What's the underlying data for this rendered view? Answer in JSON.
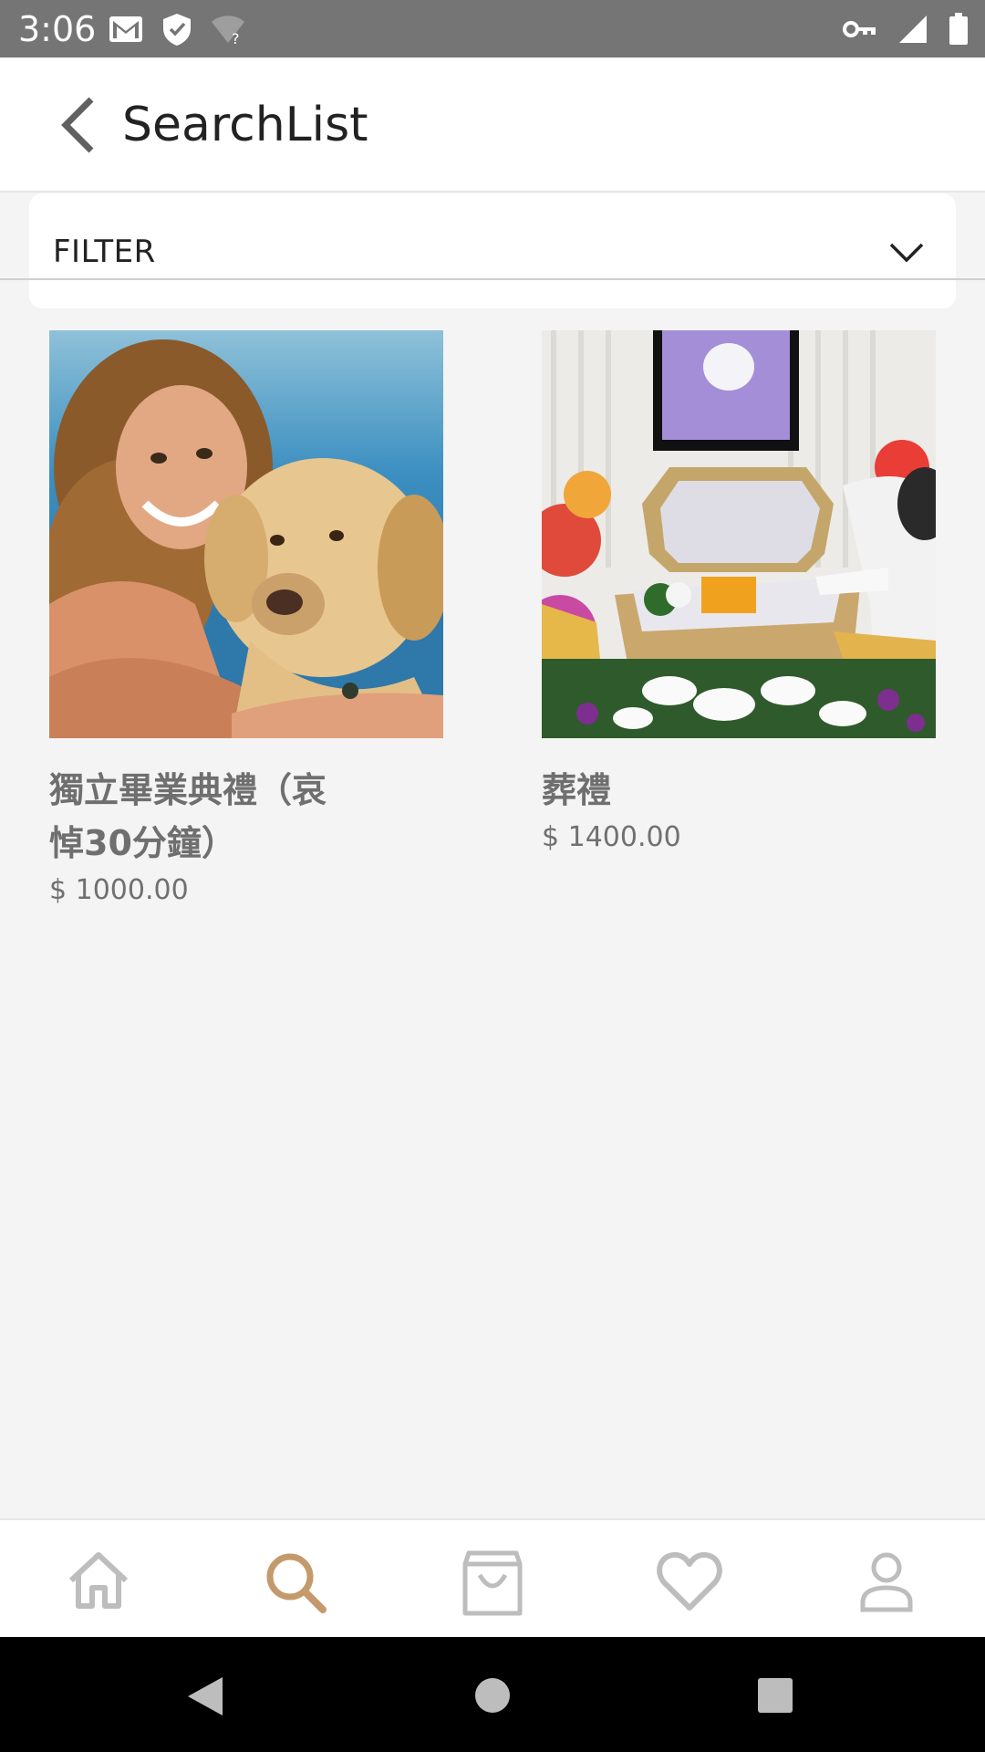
{
  "status_bar": {
    "time": "3:06",
    "left_icons": [
      "gmail-icon",
      "shield-icon",
      "wifi-question-icon"
    ],
    "right_icons": [
      "vpn-key-icon",
      "signal-icon",
      "battery-icon"
    ]
  },
  "header": {
    "title": "SearchList",
    "back_icon": "chevron-left-icon"
  },
  "filter": {
    "label": "FILTER",
    "icon": "chevron-down-icon"
  },
  "products": [
    {
      "name": "獨立畢業典禮（哀悼30分鐘）",
      "price": "$ 1000.00",
      "image": "woman-with-dog-photo"
    },
    {
      "name": "葬禮",
      "price": "$ 1400.00",
      "image": "pet-funeral-photo"
    }
  ],
  "bottom_nav": {
    "items": [
      {
        "name": "home",
        "icon": "home-icon"
      },
      {
        "name": "search",
        "icon": "search-icon",
        "active": true
      },
      {
        "name": "cart",
        "icon": "shopping-bag-icon"
      },
      {
        "name": "favorites",
        "icon": "heart-icon"
      },
      {
        "name": "profile",
        "icon": "person-icon"
      }
    ]
  },
  "colors": {
    "accent": "#c49a6c",
    "inactive_icon": "#bdbdbd",
    "status_bar": "#757575",
    "background": "#f4f4f4"
  }
}
